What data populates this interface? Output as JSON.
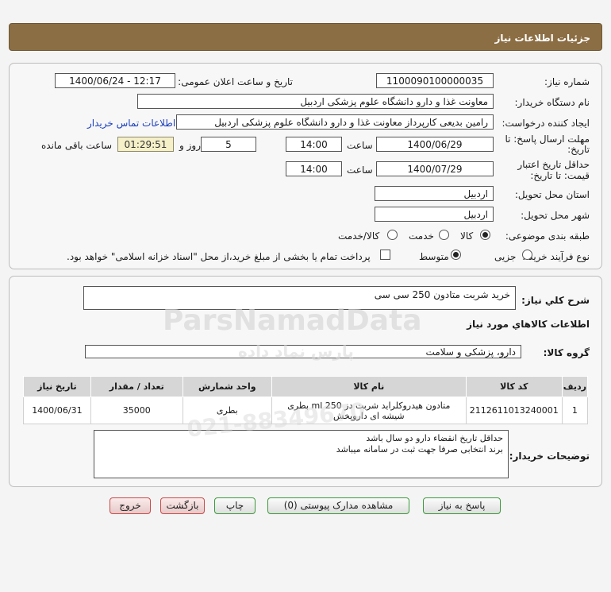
{
  "header": {
    "title": "جزئیات اطلاعات نیاز"
  },
  "info": {
    "need_number_label": "شماره نیاز:",
    "need_number": "1100090100000035",
    "announce_label": "تاریخ و ساعت اعلان عمومی:",
    "announce_value": "1400/06/24 - 12:17",
    "buyer_org_label": "نام دستگاه خریدار:",
    "buyer_org": "معاونت غذا و دارو دانشگاه علوم پزشکی اردبیل",
    "creator_label": "ایجاد کننده درخواست:",
    "creator": "رامین  بدیعی  کارپرداز  معاونت غذا و دارو دانشگاه علوم پزشکی اردبیل",
    "contact_link": "اطلاعات تماس خریدار",
    "deadline_label_1": "مهلت ارسال پاسخ: تا",
    "deadline_label_2": "تاریخ:",
    "deadline_date": "1400/06/29",
    "time_label": "ساعت",
    "deadline_time": "14:00",
    "days_value": "5",
    "days_label": "روز و",
    "remaining_time": "01:29:51",
    "remaining_label": "ساعت باقی مانده",
    "validity_label_1": "حداقل تاریخ اعتبار",
    "validity_label_2": "قیمت: تا تاریخ:",
    "validity_date": "1400/07/29",
    "validity_time": "14:00",
    "province_label": "استان محل تحویل:",
    "province": "اردبیل",
    "city_label": "شهر محل تحویل:",
    "city": "اردبیل",
    "category_label": "طبقه بندی موضوعی:",
    "category_options": [
      "کالا",
      "خدمت",
      "کالا/خدمت"
    ],
    "process_label": "نوع فرآیند خرید :",
    "process_options": [
      "جزیی",
      "متوسط"
    ],
    "payment_note": "پرداخت تمام یا بخشی از مبلغ خرید،از محل \"اسناد خزانه اسلامی\" خواهد بود."
  },
  "details": {
    "summary_label": "شرح کلي نياز:",
    "summary": "خرید شربت متادون 250 سی سی",
    "goods_info_title": "اطلاعات کالاهاي مورد نياز",
    "goods_group_label": "گروه کالا:",
    "goods_group": "دارو، پزشکی و سلامت",
    "table": {
      "headers": [
        "ردیف",
        "کد کالا",
        "نام کالا",
        "واحد شمارش",
        "تعداد / مقدار",
        "تاریخ نیاز"
      ],
      "rows": [
        [
          "1",
          "2112611013240001",
          "متادون هیدروکلراید شربت دز ml 250 بطری شیشه ای داروپخش",
          "بطری",
          "35000",
          "1400/06/31"
        ]
      ]
    },
    "buyer_notes_label": "توضیحات خریدار:",
    "buyer_notes_line1": "حداقل تاریخ انقضاء دارو دو سال باشد",
    "buyer_notes_line2": "برند انتخابی صرفا جهت ثبت در سامانه میباشد"
  },
  "buttons": {
    "reply": "پاسخ به نیاز",
    "view_docs": "مشاهده مدارک پیوستی (0)",
    "print": "چاپ",
    "back": "بازگشت",
    "exit": "خروج"
  },
  "watermark": {
    "brand": "ParsNamadData",
    "brand_fa": "پارس نماد داده",
    "phone": "021-88349670"
  }
}
